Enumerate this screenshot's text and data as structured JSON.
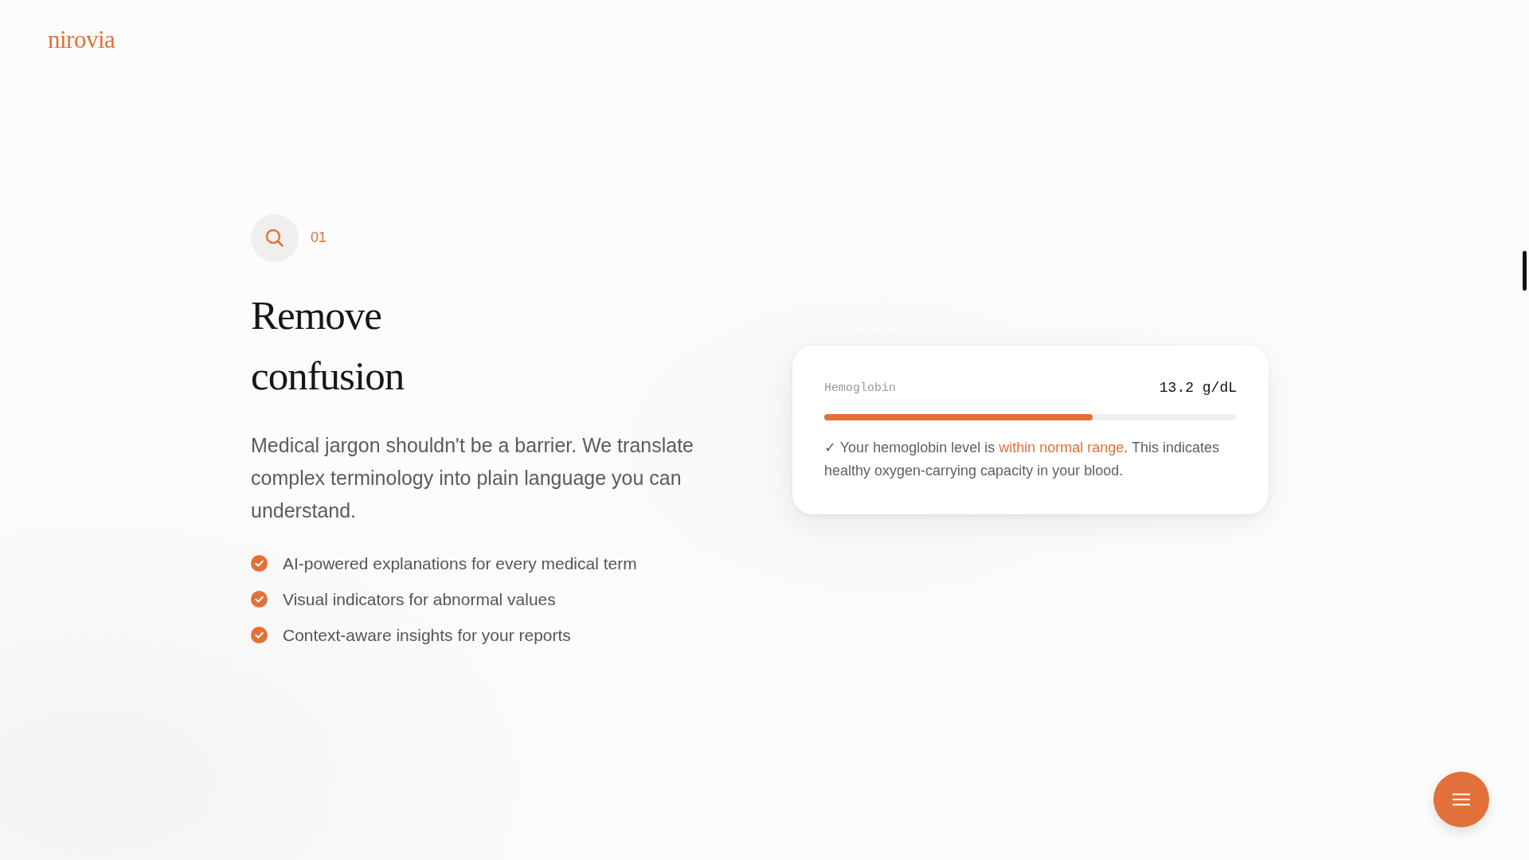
{
  "brand": {
    "logo": "nirovia"
  },
  "feature": {
    "number": "01",
    "title": "Remove confusion",
    "description": "Medical jargon shouldn't be a barrier. We translate complex terminology into plain language you can understand.",
    "points": [
      {
        "label": "AI-powered explanations for every medical term"
      },
      {
        "label": "Visual indicators for abnormal values"
      },
      {
        "label": "Context-aware insights for your reports"
      }
    ]
  },
  "result_card": {
    "label": "Hemoglobin",
    "value": "13.2 g/dL",
    "level": 0.65,
    "note": {
      "before": "✓ Your hemoglobin level is ",
      "highlight": "within normal range",
      "after": ". This indicates healthy oxygen-carrying capacity in your blood."
    }
  }
}
